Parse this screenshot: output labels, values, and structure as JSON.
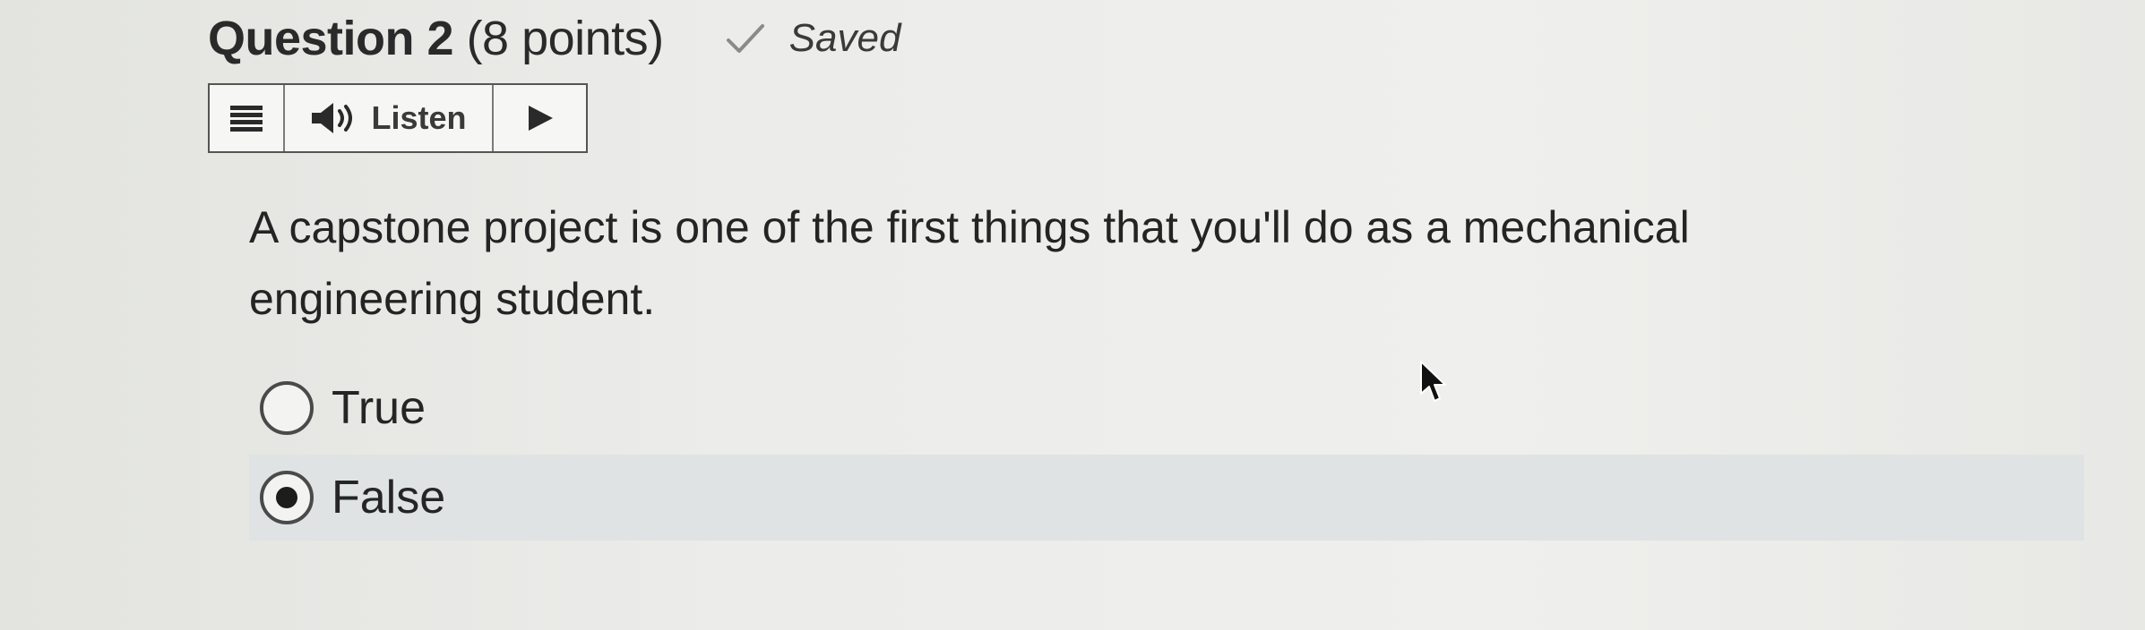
{
  "question": {
    "title_bold": "Question 2",
    "title_points": "(8 points)",
    "saved_label": "Saved",
    "text": "A capstone project is one of the first things that you'll do as a mechanical engineering student."
  },
  "toolbar": {
    "listen_label": "Listen",
    "icons": [
      "menu-icon",
      "speaker-icon",
      "play-icon"
    ]
  },
  "answers": {
    "options": [
      {
        "label": "True",
        "selected": false
      },
      {
        "label": "False",
        "selected": true
      }
    ]
  },
  "colors": {
    "selected_row": "#dfe3e3",
    "text": "#242424",
    "check_mark": "#8a8a8a"
  }
}
